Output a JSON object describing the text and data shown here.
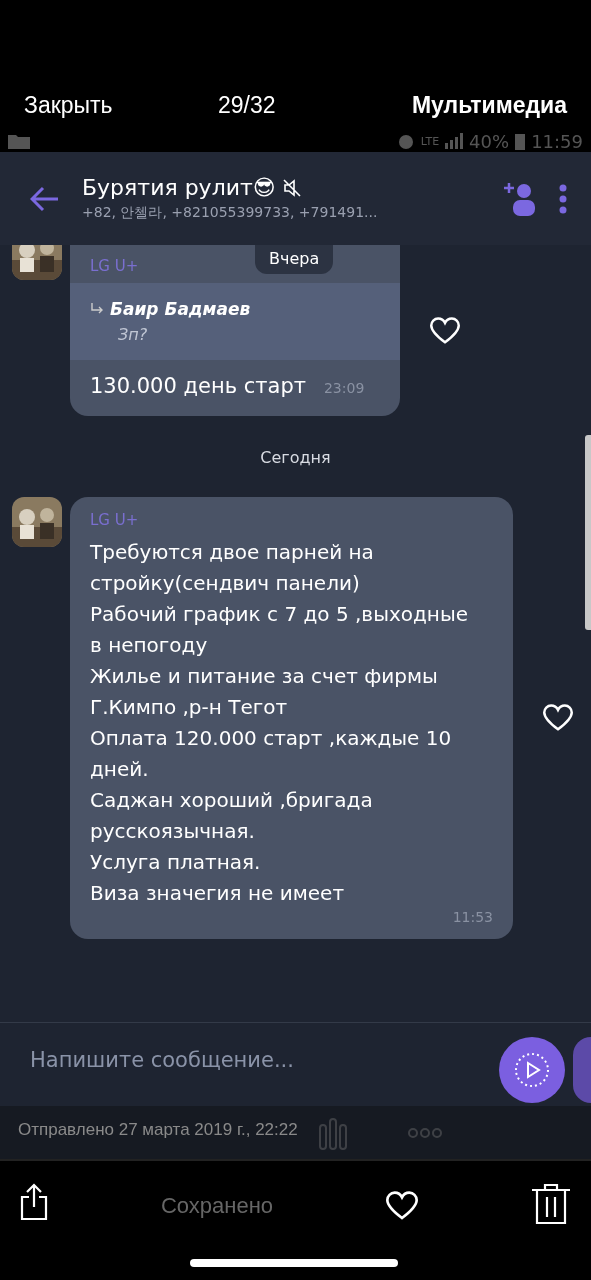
{
  "viewer": {
    "close": "Закрыть",
    "counter": "29/32",
    "media": "Мультимедиа",
    "caption": "Отправлено 27 марта 2019 г., 22:22",
    "saved": "Сохранено"
  },
  "status_bar": {
    "network": "LTE",
    "battery": "40%",
    "time": "11:59"
  },
  "chat": {
    "title": "Бурятия рулит😎",
    "muted": true,
    "members": "+82, 안첼라, +821055399733, +791491..."
  },
  "date_chip": "Вчера",
  "items": [
    {
      "kind": "message",
      "sender": "LG U+",
      "reply": {
        "author": "Баир Бадмаев",
        "text": "Зп?"
      },
      "text": "130.000 день старт",
      "time": "23:09"
    },
    {
      "kind": "date",
      "text": "Сегодня"
    },
    {
      "kind": "message",
      "sender": "LG U+",
      "text": "Требуются двое парней на стройку(сендвич панели)\nРабочий график с 7 до 5 ,выходные в непогоду\nЖилье и питание за счет фирмы\nГ.Кимпо ,р-н Тегот\nОплата 120.000 старт ,каждые 10 дней.\nСаджан хороший ,бригада русскоязычная.\nУслуга платная.\nВиза значегия не имеет",
      "time": "11:53"
    }
  ],
  "composer": {
    "placeholder": "Напишите сообщение..."
  }
}
